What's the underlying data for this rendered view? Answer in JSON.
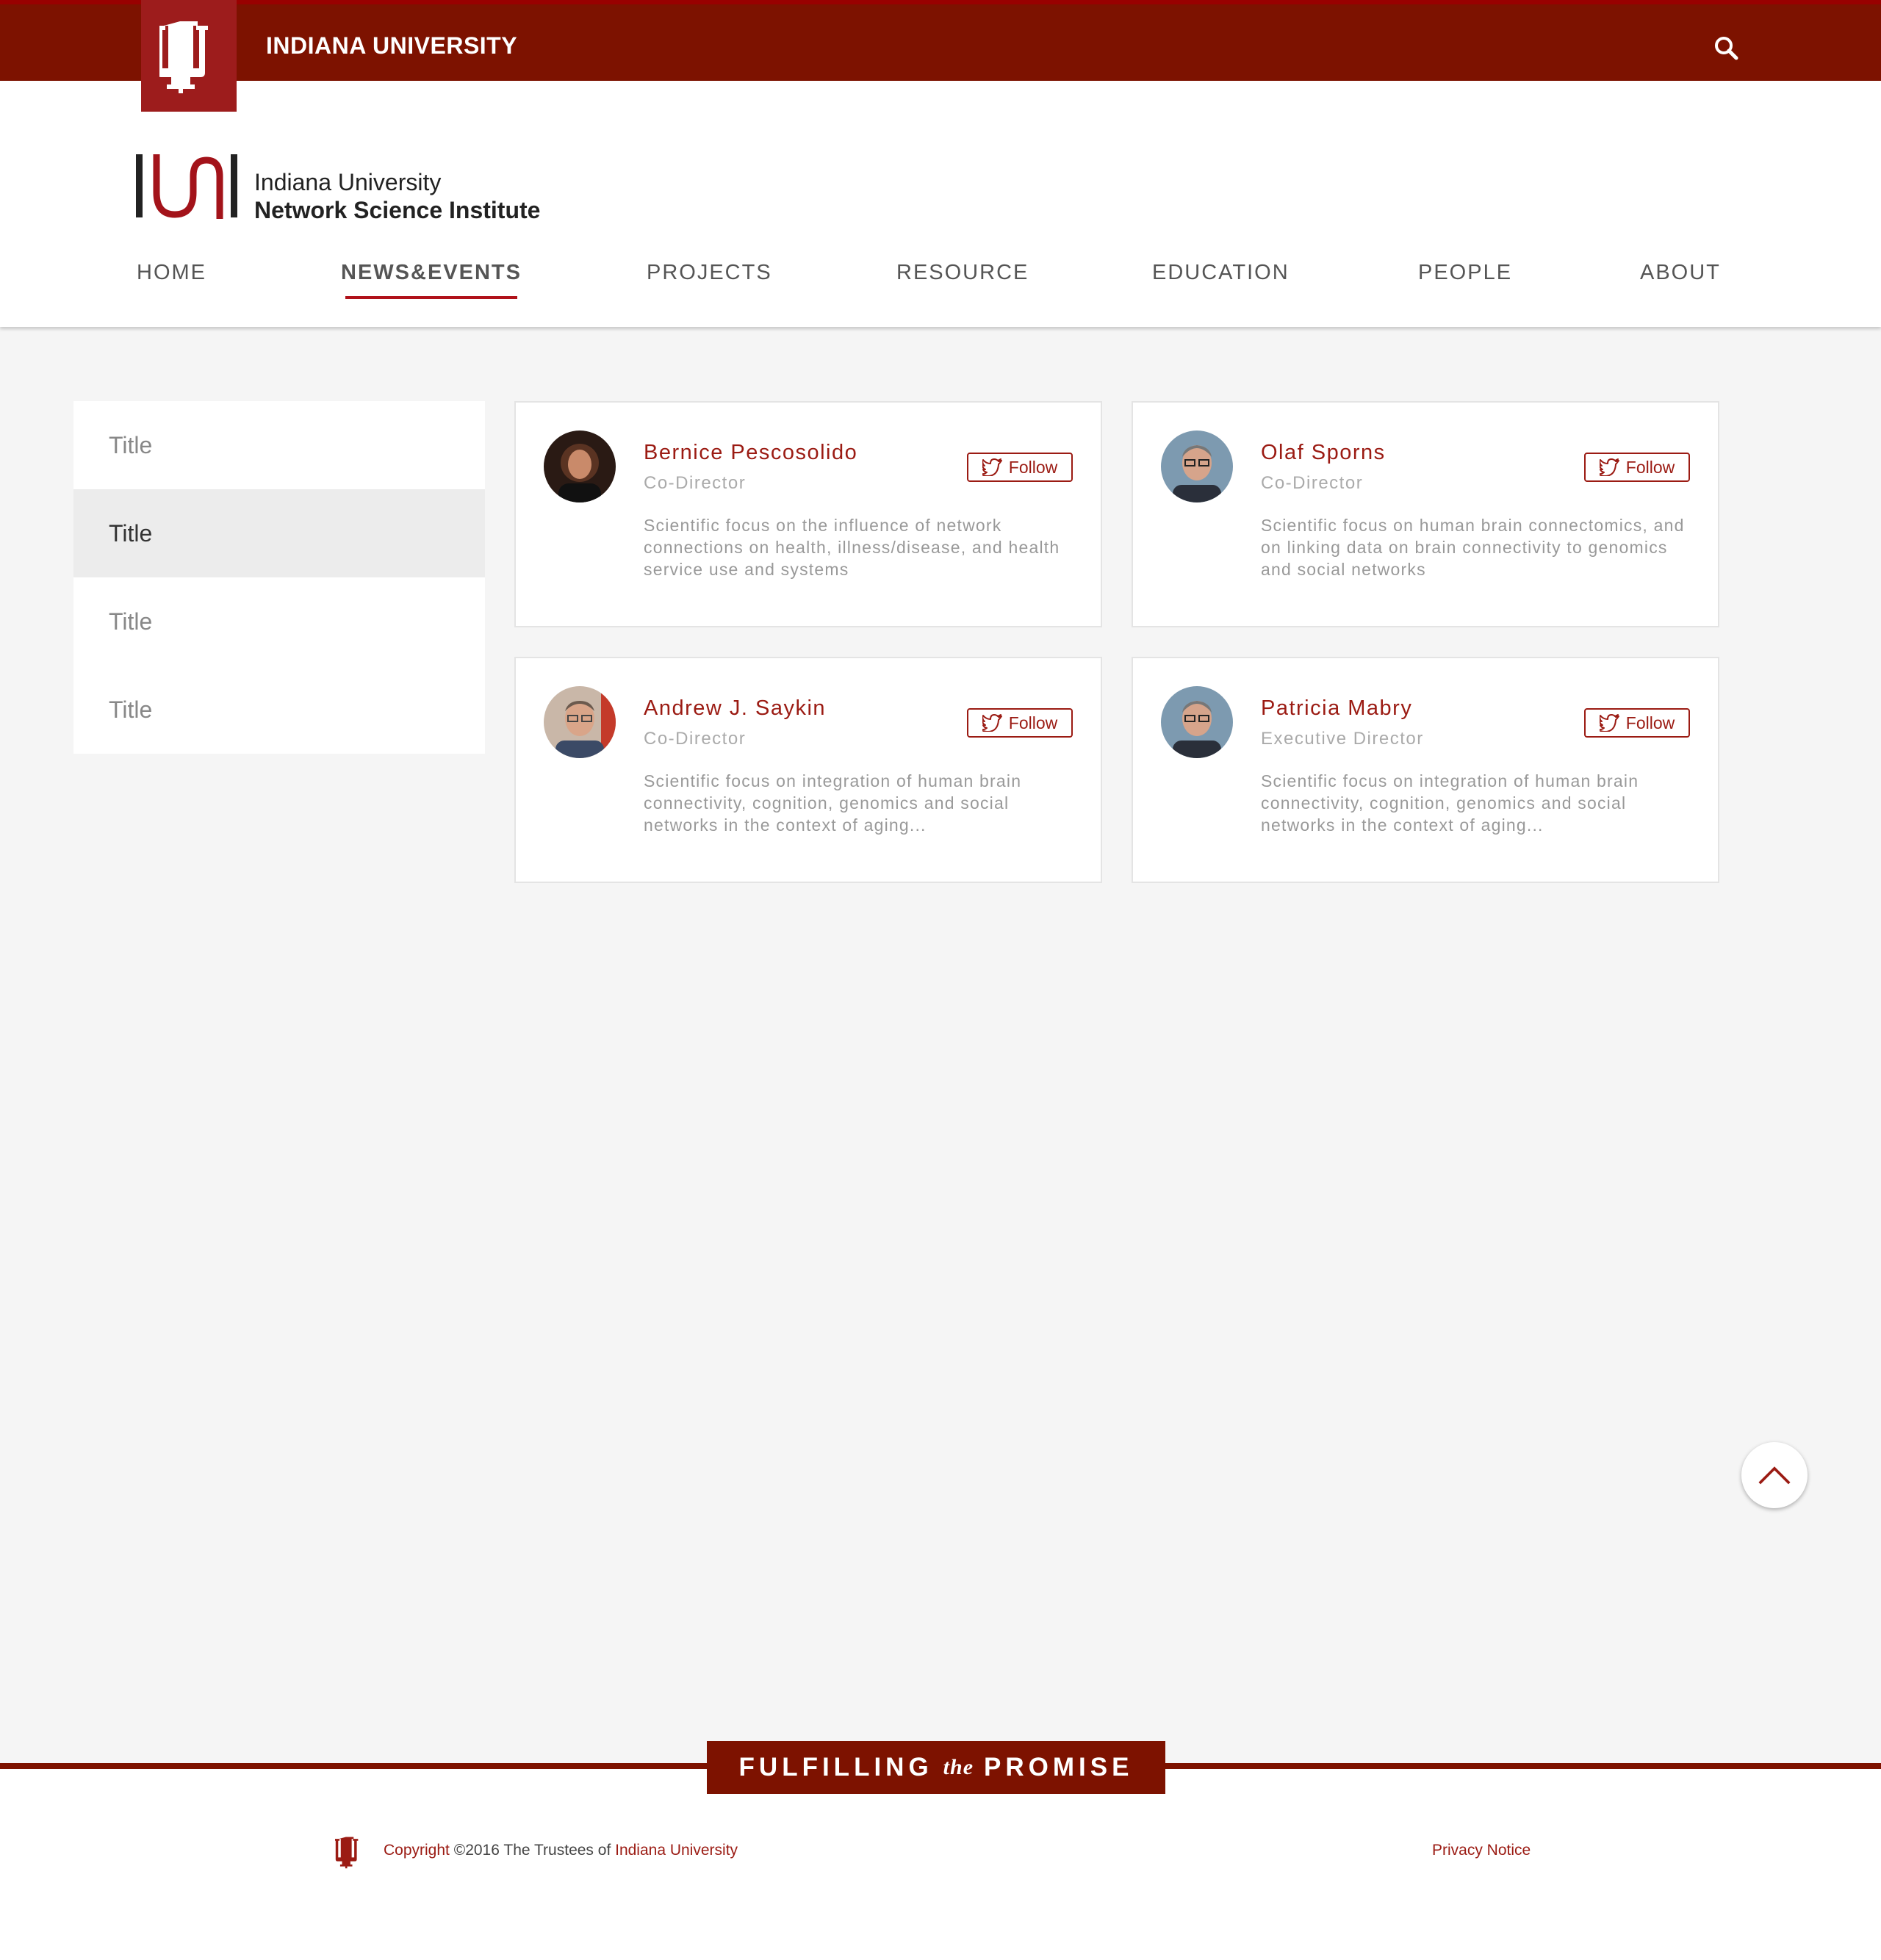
{
  "topbar": {
    "university_name": "INDIANA UNIVERSITY",
    "brand_color": "#7d1200",
    "logo_icon": "iu-trident-icon",
    "search_icon": "search-icon"
  },
  "header": {
    "logo_line1": "Indiana University",
    "logo_line2": "Network Science Institute"
  },
  "nav": {
    "items": [
      {
        "label": "HOME"
      },
      {
        "label": "NEWS&EVENTS",
        "active": true
      },
      {
        "label": "PROJECTS"
      },
      {
        "label": "RESOURCE"
      },
      {
        "label": "EDUCATION"
      },
      {
        "label": "PEOPLE"
      },
      {
        "label": "ABOUT"
      }
    ]
  },
  "sidebar": {
    "items": [
      {
        "label": "Title"
      },
      {
        "label": "Title",
        "active": true
      },
      {
        "label": "Title"
      },
      {
        "label": "Title"
      }
    ]
  },
  "people": [
    {
      "name": "Bernice Pescosolido",
      "role": "Co-Director",
      "desc": "Scientific focus on the influence of network connections on health, illness/disease, and health service use and systems",
      "follow": "Follow"
    },
    {
      "name": "Olaf Sporns",
      "role": "Co-Director",
      "desc": "Scientific focus on human brain connectomics, and on linking data on brain connectivity to genomics and social networks",
      "follow": "Follow"
    },
    {
      "name": "Andrew J. Saykin",
      "role": "Co-Director",
      "desc": "Scientific focus on integration of human brain connectivity, cognition, genomics and social networks in the context of aging...",
      "follow": "Follow"
    },
    {
      "name": "Patricia Mabry",
      "role": "Executive Director",
      "desc": "Scientific focus on integration of human brain connectivity, cognition, genomics and social networks in the context of aging...",
      "follow": "Follow"
    }
  ],
  "footer": {
    "promise_left": "FULFILLING",
    "promise_mid": "the",
    "promise_right": "PROMISE",
    "copyright_prefix": "Copyright",
    "copyright_mid": " ©2016 The Trustees of ",
    "copyright_link": "Indiana University",
    "privacy": "Privacy Notice"
  }
}
